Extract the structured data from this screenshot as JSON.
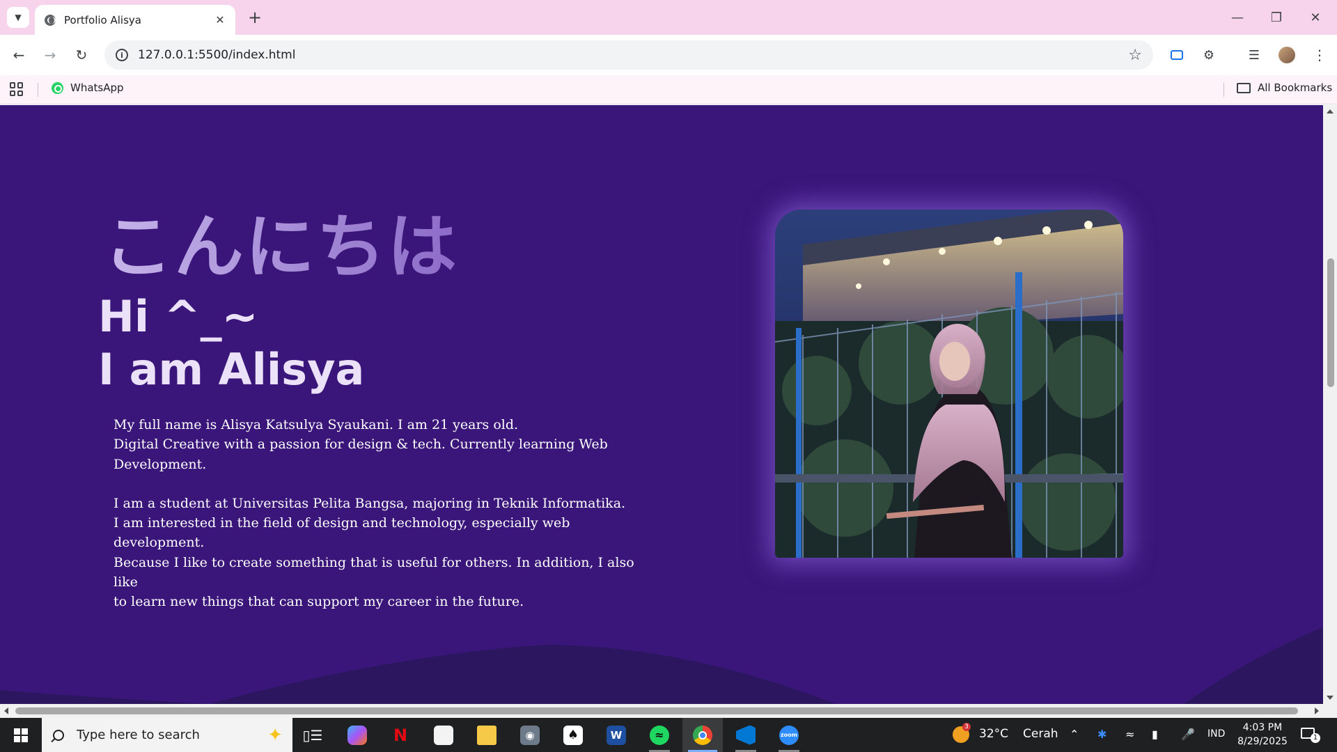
{
  "browser": {
    "tab_title": "Portfolio Alisya",
    "tab_close": "✕",
    "new_tab": "+",
    "url": "127.0.0.1:5500/index.html",
    "window_controls": {
      "minimize": "—",
      "restore": "❐",
      "close": "✕"
    }
  },
  "bookmarks": {
    "items": [
      {
        "label": "WhatsApp",
        "icon": "whatsapp-icon"
      }
    ],
    "all_bookmarks": "All Bookmarks"
  },
  "page": {
    "greeting_jp": "こんにちは",
    "greeting_hi": "Hi ^_~",
    "greeting_name": "I am Alisya",
    "bio": [
      "My full name is Alisya Katsulya Syaukani. I am 21 years old.",
      "Digital Creative with a passion for design & tech. Currently learning Web",
      "Development.",
      "I am a student at Universitas Pelita Bangsa, majoring in Teknik Informatika.",
      "I am interested in the field of design and technology, especially web development.",
      "Because I like to create something that is useful for others. In addition, I also like",
      "to learn new things that can support my career in the future."
    ],
    "colors": {
      "background": "#3a167a",
      "wave": "#2c1660",
      "text": "#ffffff"
    }
  },
  "taskbar": {
    "search_placeholder": "Type here to search",
    "weather_temp": "32°C",
    "weather_desc": "Cerah",
    "weather_badge": "3",
    "language": "IND",
    "time": "4:03 PM",
    "date": "8/29/2025",
    "notification_count": "1",
    "apps": [
      "task-view",
      "copilot",
      "netflix",
      "microsoft-store",
      "file-explorer",
      "camera",
      "solitaire",
      "app-w",
      "spotify",
      "chrome",
      "vscode",
      "zoom"
    ]
  }
}
